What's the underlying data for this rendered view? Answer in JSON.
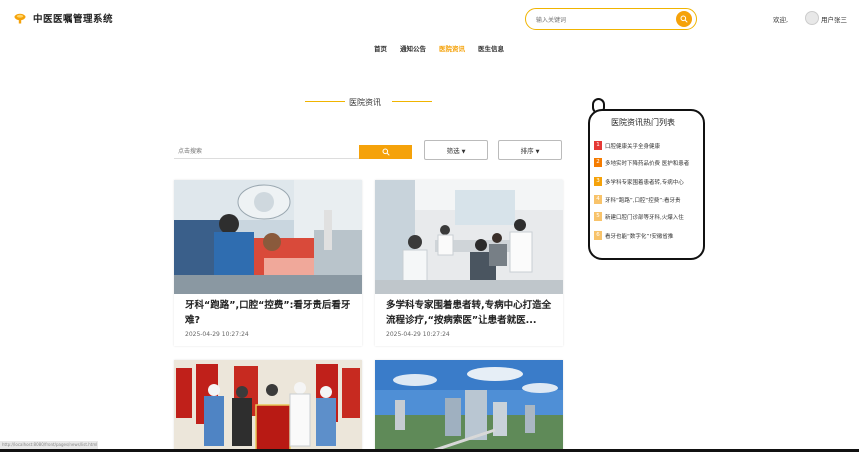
{
  "app": {
    "title": "中医医嘱管理系统"
  },
  "search": {
    "placeholder": "输入关键词"
  },
  "user": {
    "welcome": "欢迎,",
    "name": "用户张三"
  },
  "nav": {
    "items": [
      {
        "label": "首页",
        "active": false
      },
      {
        "label": "通知公告",
        "active": false
      },
      {
        "label": "医院资讯",
        "active": true
      },
      {
        "label": "医生信息",
        "active": false
      }
    ]
  },
  "section": {
    "title": "医院资讯"
  },
  "filter": {
    "placeholder": "点击搜索",
    "sort_label": "筛选",
    "order_label": "排序"
  },
  "cards": [
    {
      "title": "牙科“跑路”,口腔“控费”:看牙贵后看牙难?",
      "date": "2025-04-29 10:27:24"
    },
    {
      "title": "多学科专家围着患者转,专病中心打造全流程诊疗,“按病索医”让患者就医...",
      "date": "2025-04-29 10:27:24"
    },
    {
      "title": "",
      "date": ""
    },
    {
      "title": "",
      "date": ""
    }
  ],
  "hot": {
    "title": "医院资讯热门列表",
    "items": [
      {
        "num": "1",
        "text": "口腔健康关乎全身健康"
      },
      {
        "num": "2",
        "text": "多地实时下降药品价费 医护和患者"
      },
      {
        "num": "3",
        "text": "多学科专家围着患者转,专病中心"
      },
      {
        "num": "4",
        "text": "牙科“跑路”,口腔“控费”:看牙贵"
      },
      {
        "num": "5",
        "text": "新建口腔门诊部等牙科,火爆入住"
      },
      {
        "num": "6",
        "text": "看牙也能“数字化”!安徽省推"
      }
    ]
  },
  "colors": {
    "accent": "#f5a20a",
    "rank1": "#e53935",
    "rank2": "#f57c00",
    "rank3": "#f5a20a",
    "rank_other": "#f8c36a"
  },
  "status_url": "http://localhost:8080/front/pages/news/list.html"
}
